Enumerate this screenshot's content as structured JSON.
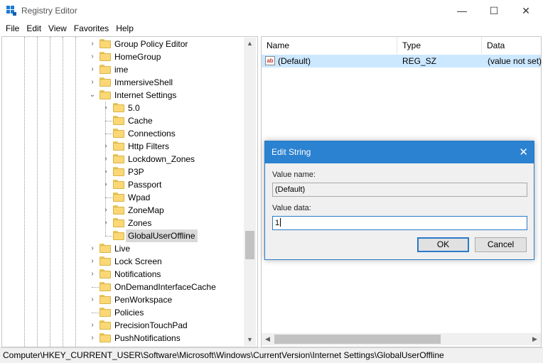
{
  "window": {
    "title": "Registry Editor",
    "minimize_glyph": "—",
    "maximize_glyph": "☐",
    "close_glyph": "✕"
  },
  "menu": [
    "File",
    "Edit",
    "View",
    "Favorites",
    "Help"
  ],
  "tree": {
    "items": [
      {
        "label": "Group Policy Editor",
        "level": 0,
        "expander": "›"
      },
      {
        "label": "HomeGroup",
        "level": 0,
        "expander": "›"
      },
      {
        "label": "ime",
        "level": 0,
        "expander": "›"
      },
      {
        "label": "ImmersiveShell",
        "level": 0,
        "expander": "›"
      },
      {
        "label": "Internet Settings",
        "level": 0,
        "expander": "⌄"
      },
      {
        "label": "5.0",
        "level": 1,
        "expander": "›"
      },
      {
        "label": "Cache",
        "level": 1,
        "expander": ""
      },
      {
        "label": "Connections",
        "level": 1,
        "expander": ""
      },
      {
        "label": "Http Filters",
        "level": 1,
        "expander": "›"
      },
      {
        "label": "Lockdown_Zones",
        "level": 1,
        "expander": "›"
      },
      {
        "label": "P3P",
        "level": 1,
        "expander": "›"
      },
      {
        "label": "Passport",
        "level": 1,
        "expander": "›"
      },
      {
        "label": "Wpad",
        "level": 1,
        "expander": ""
      },
      {
        "label": "ZoneMap",
        "level": 1,
        "expander": "›"
      },
      {
        "label": "Zones",
        "level": 1,
        "expander": "›"
      },
      {
        "label": "GlobalUserOffline",
        "level": 1,
        "expander": "",
        "selected": true
      },
      {
        "label": "Live",
        "level": 0,
        "expander": "›"
      },
      {
        "label": "Lock Screen",
        "level": 0,
        "expander": "›"
      },
      {
        "label": "Notifications",
        "level": 0,
        "expander": "›"
      },
      {
        "label": "OnDemandInterfaceCache",
        "level": 0,
        "expander": ""
      },
      {
        "label": "PenWorkspace",
        "level": 0,
        "expander": "›"
      },
      {
        "label": "Policies",
        "level": 0,
        "expander": ""
      },
      {
        "label": "PrecisionTouchPad",
        "level": 0,
        "expander": "›"
      },
      {
        "label": "PushNotifications",
        "level": 0,
        "expander": "›"
      }
    ]
  },
  "list": {
    "columns": [
      "Name",
      "Type",
      "Data"
    ],
    "rows": [
      {
        "name": "(Default)",
        "type": "REG_SZ",
        "data": "(value not set)",
        "icon": "ab-string-icon",
        "icon_text": "ab"
      }
    ]
  },
  "status_path": "Computer\\HKEY_CURRENT_USER\\Software\\Microsoft\\Windows\\CurrentVersion\\Internet Settings\\GlobalUserOffline",
  "dialog": {
    "title": "Edit String",
    "close_glyph": "✕",
    "value_name_label": "Value name:",
    "value_name": "(Default)",
    "value_data_label": "Value data:",
    "value_data": "1",
    "ok_label": "OK",
    "cancel_label": "Cancel"
  },
  "colors": {
    "accent": "#2b82d0",
    "selection": "#cce8ff",
    "folder": "#fbd775"
  }
}
